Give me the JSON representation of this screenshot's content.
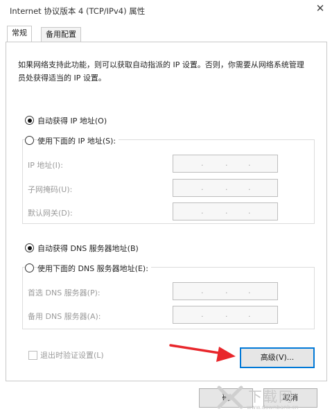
{
  "window": {
    "title": "Internet 协议版本 4 (TCP/IPv4) 属性",
    "close_glyph": "✕"
  },
  "tabs": [
    {
      "label": "常规"
    },
    {
      "label": "备用配置"
    }
  ],
  "description": "如果网络支持此功能，则可以获取自动指派的 IP 设置。否则，你需要从网络系统管理员处获得适当的 IP 设置。",
  "ip": {
    "auto_label": "自动获得 IP 地址(O)",
    "manual_label": "使用下面的 IP 地址(S):",
    "selected": "auto",
    "fields": [
      {
        "label": "IP 地址(I):",
        "value": ".  .  ."
      },
      {
        "label": "子网掩码(U):",
        "value": ".  .  ."
      },
      {
        "label": "默认网关(D):",
        "value": ".  .  ."
      }
    ]
  },
  "dns": {
    "auto_label": "自动获得 DNS 服务器地址(B)",
    "manual_label": "使用下面的 DNS 服务器地址(E):",
    "selected": "auto",
    "fields": [
      {
        "label": "首选 DNS 服务器(P):",
        "value": ".  .  ."
      },
      {
        "label": "备用 DNS 服务器(A):",
        "value": ".  .  ."
      }
    ]
  },
  "validate": {
    "label": "退出时验证设置(L)",
    "checked": false
  },
  "buttons": {
    "advanced": "高级(V)...",
    "ok": "确",
    "cancel": "取消"
  },
  "watermark": {
    "text": "下载网",
    "url": "www.downbank.cn"
  },
  "colors": {
    "arrow": "#e8262b",
    "focus": "#0078d7"
  }
}
